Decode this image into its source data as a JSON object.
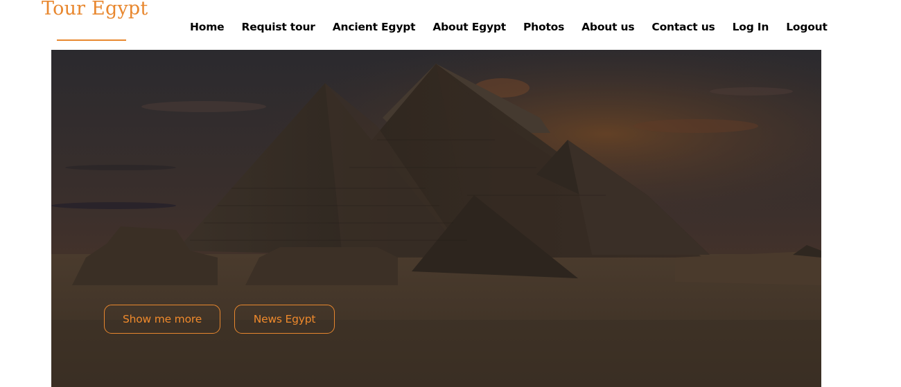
{
  "site": {
    "logo_text": "Tour Egypt",
    "accent_color": "#e8872e"
  },
  "nav": {
    "items": [
      {
        "label": "Home"
      },
      {
        "label": "Requist tour"
      },
      {
        "label": "Ancient Egypt"
      },
      {
        "label": "About Egypt"
      },
      {
        "label": "Photos"
      },
      {
        "label": "About us"
      },
      {
        "label": "Contact us"
      },
      {
        "label": "Log In"
      },
      {
        "label": "Logout"
      }
    ]
  },
  "hero": {
    "image_name": "giza-pyramids-photo",
    "buttons": {
      "show_more": "Show me more",
      "news": "News Egypt"
    }
  }
}
